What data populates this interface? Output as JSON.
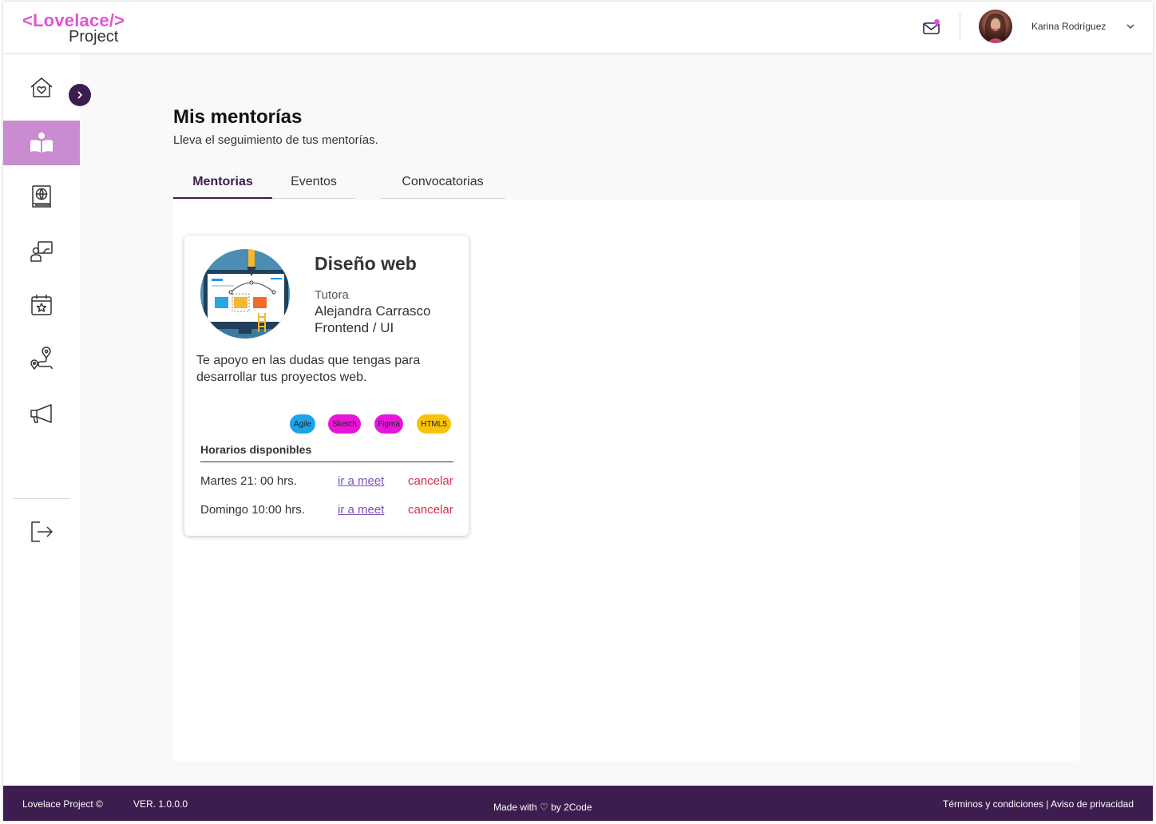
{
  "brand": {
    "top": "<Lovelace/>",
    "bottom": "Project",
    "color": "#e353d6"
  },
  "header": {
    "user_name": "Karina Rodríguez",
    "mail_icon": "mail-icon",
    "has_notification": true
  },
  "sidebar": {
    "items": [
      {
        "name": "home-heart-icon",
        "active": false
      },
      {
        "name": "open-book-icon",
        "active": true
      },
      {
        "name": "globe-book-icon",
        "active": false
      },
      {
        "name": "teacher-board-icon",
        "active": false
      },
      {
        "name": "calendar-star-icon",
        "active": false
      },
      {
        "name": "route-pin-icon",
        "active": false
      },
      {
        "name": "megaphone-icon",
        "active": false
      }
    ],
    "logout_icon": "logout-icon",
    "active_color": "#c98cd0"
  },
  "page": {
    "title": "Mis mentorías",
    "subtitle": "Lleva el seguimiento de tus mentorías.",
    "tabs": [
      {
        "label": "Mentorias",
        "active": true
      },
      {
        "label": "Eventos",
        "active": false
      },
      {
        "label": "Convocatorias",
        "active": false
      }
    ]
  },
  "card": {
    "course": "Diseño web",
    "role": "Tutora",
    "tutor": "Alejandra Carrasco",
    "speciality": "Frontend / UI",
    "description": "Te apoyo en las dudas que tengas para desarrollar tus proyectos web.",
    "tags": [
      {
        "label": "Agile",
        "color": "#1ba4e8"
      },
      {
        "label": "Sketch",
        "color": "#e617d9"
      },
      {
        "label": "Figma",
        "color": "#e617d9"
      },
      {
        "label": "HTML5",
        "color": "#f8c30a"
      }
    ],
    "schedule_header": "Horarios disponibles",
    "schedule": [
      {
        "time": "Martes 21: 00 hrs.",
        "meet": "ir a meet",
        "cancel": "cancelar"
      },
      {
        "time": "Domingo 10:00 hrs.",
        "meet": "ir a meet",
        "cancel": "cancelar"
      }
    ]
  },
  "footer": {
    "copyright": "Lovelace Project ©",
    "version": "VER. 1.0.0.0",
    "made_with": "Made with ♡ by 2Code",
    "legal": "Términos y condiciones | Aviso de privacidad",
    "color": "#3d1d4f"
  }
}
